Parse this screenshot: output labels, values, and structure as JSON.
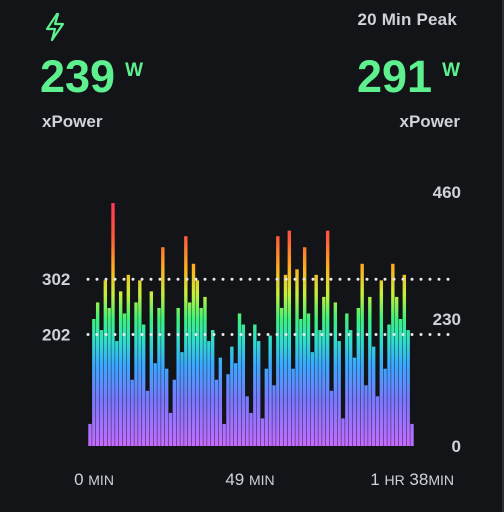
{
  "header": {
    "icon": "lightning-bolt-icon",
    "peak_label": "20 Min Peak"
  },
  "metrics": {
    "left": {
      "value": "239",
      "unit": "W",
      "label": "xPower"
    },
    "right": {
      "value": "291",
      "unit": "W",
      "label": "xPower"
    }
  },
  "colors": {
    "accent": "#5ef08f",
    "background": "#121418",
    "text": "#cfd3d8"
  },
  "chart_data": {
    "type": "bar",
    "y_ticks_right": [
      "460",
      "230",
      "0"
    ],
    "y_ticks_left": [
      "302",
      "202"
    ],
    "reference_lines": [
      302,
      202
    ],
    "ylim": [
      0,
      460
    ],
    "x_ticks": [
      {
        "num": "0",
        "unit": "MIN"
      },
      {
        "num": "49",
        "unit": "MIN"
      },
      {
        "num": "1",
        "unit": "HR",
        "num2": "38",
        "unit2": "MIN"
      }
    ],
    "xlim_min": [
      0,
      98
    ],
    "values": [
      40,
      230,
      260,
      210,
      300,
      250,
      440,
      190,
      280,
      240,
      310,
      120,
      260,
      300,
      220,
      100,
      280,
      150,
      250,
      360,
      140,
      60,
      120,
      250,
      170,
      380,
      260,
      330,
      300,
      250,
      270,
      190,
      210,
      120,
      160,
      40,
      130,
      180,
      150,
      240,
      220,
      90,
      60,
      220,
      190,
      50,
      140,
      200,
      110,
      380,
      250,
      310,
      390,
      140,
      320,
      230,
      360,
      240,
      170,
      310,
      210,
      270,
      390,
      100,
      260,
      190,
      50,
      240,
      210,
      160,
      250,
      330,
      110,
      270,
      180,
      90,
      300,
      140,
      220,
      330,
      270,
      230,
      310,
      210,
      40
    ]
  }
}
